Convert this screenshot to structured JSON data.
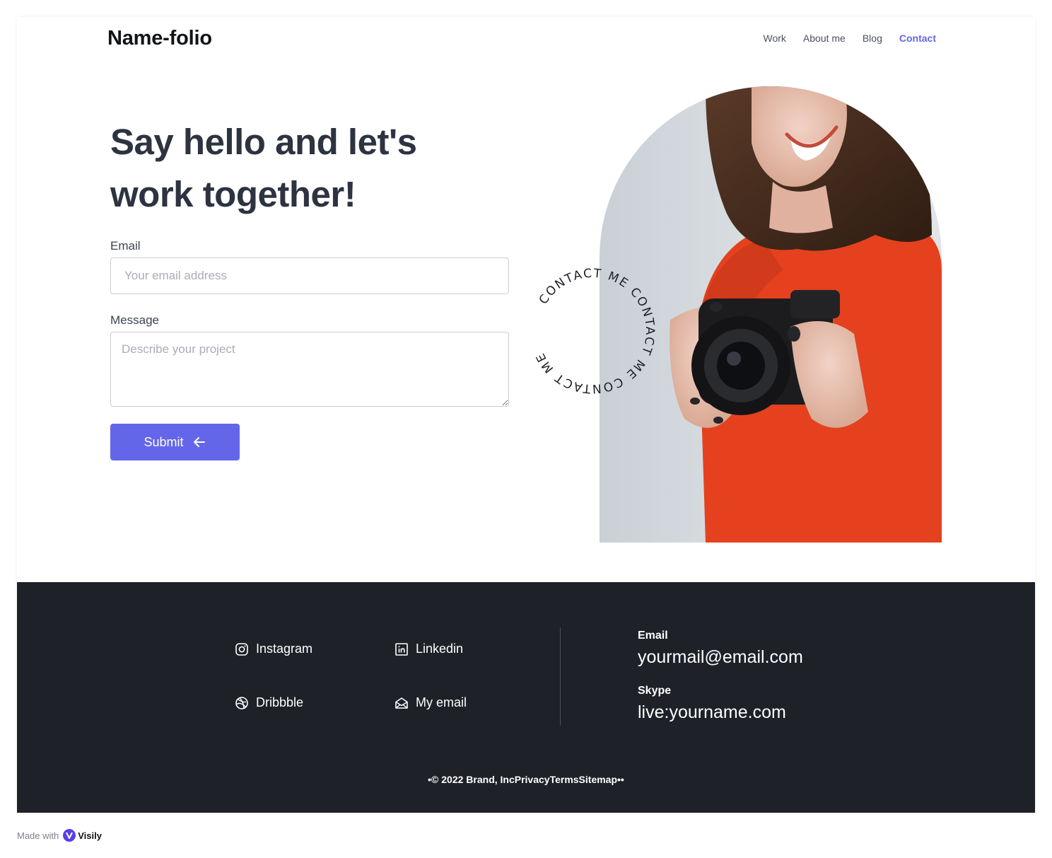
{
  "header": {
    "brand": "Name-folio",
    "nav": [
      {
        "label": "Work"
      },
      {
        "label": "About me"
      },
      {
        "label": "Blog"
      },
      {
        "label": "Contact",
        "active": true
      }
    ]
  },
  "hero": {
    "headline_line1": "Say hello and let's",
    "headline_line2": "work together!",
    "email_label": "Email",
    "email_placeholder": "Your email address",
    "email_value": "",
    "message_label": "Message",
    "message_placeholder": "Describe your project",
    "message_value": "",
    "submit_label": "Submit",
    "badge_text": "CONTACT ME CONTACT ME CONTACT ME"
  },
  "footer": {
    "socials": [
      {
        "label": "Instagram",
        "icon": "instagram-icon"
      },
      {
        "label": "Linkedin",
        "icon": "linkedin-icon"
      },
      {
        "label": "Dribbble",
        "icon": "dribbble-icon"
      },
      {
        "label": "My email",
        "icon": "envelope-open-icon"
      }
    ],
    "email_label": "Email",
    "email_value": "yourmail@email.com",
    "skype_label": "Skype",
    "skype_value": "live:yourname.com",
    "copyright": "•© 2022 Brand, IncPrivacyTermsSitemap••"
  },
  "made_with": {
    "prefix": "Made with",
    "brand": "Visily"
  },
  "colors": {
    "accent": "#6466e9",
    "footer_bg": "#1e2128",
    "heading": "#2d3340",
    "sweater": "#e5411f"
  }
}
